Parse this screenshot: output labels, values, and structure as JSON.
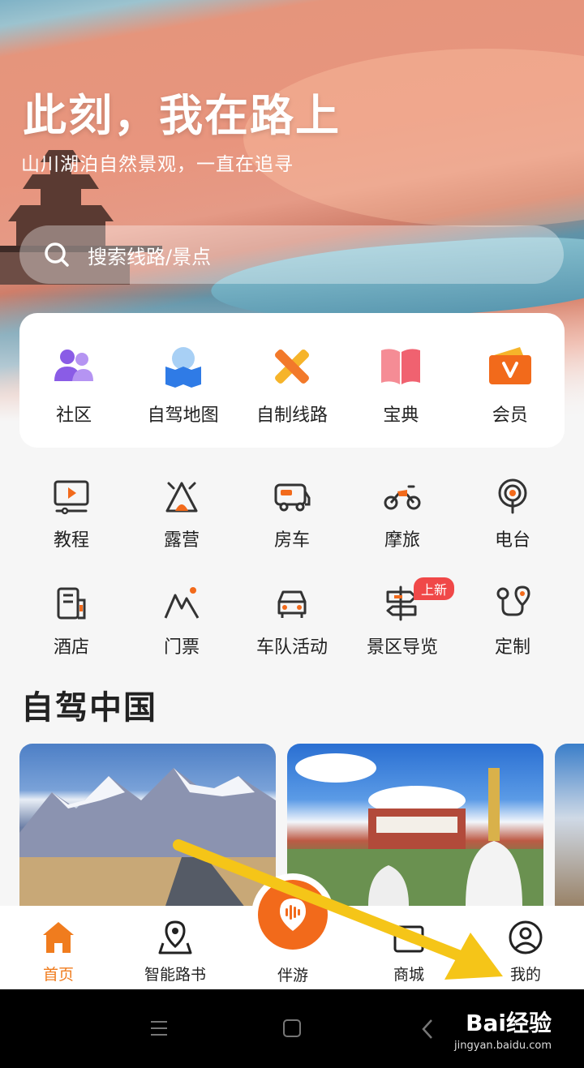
{
  "hero": {
    "title": "此刻，我在路上",
    "subtitle": "山川湖泊自然景观，一直在追寻",
    "search_placeholder": "搜索线路/景点"
  },
  "primary_menu": [
    {
      "label": "社区",
      "icon": "community-icon"
    },
    {
      "label": "自驾地图",
      "icon": "map-icon"
    },
    {
      "label": "自制线路",
      "icon": "route-icon"
    },
    {
      "label": "宝典",
      "icon": "book-icon"
    },
    {
      "label": "会员",
      "icon": "vip-icon"
    }
  ],
  "secondary_menu": [
    {
      "label": "教程",
      "icon": "tutorial-icon"
    },
    {
      "label": "露营",
      "icon": "camping-icon"
    },
    {
      "label": "房车",
      "icon": "rv-icon"
    },
    {
      "label": "摩旅",
      "icon": "motorcycle-icon"
    },
    {
      "label": "电台",
      "icon": "radio-icon"
    },
    {
      "label": "酒店",
      "icon": "hotel-icon"
    },
    {
      "label": "门票",
      "icon": "ticket-icon"
    },
    {
      "label": "车队活动",
      "icon": "convoy-icon"
    },
    {
      "label": "景区导览",
      "icon": "guide-icon",
      "badge": "上新"
    },
    {
      "label": "定制",
      "icon": "custom-icon"
    }
  ],
  "section": {
    "title": "自驾中国"
  },
  "bottom_nav": [
    {
      "label": "首页",
      "icon": "home-icon",
      "active": true
    },
    {
      "label": "智能路书",
      "icon": "roadbook-icon"
    },
    {
      "label": "伴游",
      "icon": "companion-icon"
    },
    {
      "label": "商城",
      "icon": "shop-icon"
    },
    {
      "label": "我的",
      "icon": "profile-icon"
    }
  ],
  "watermark": {
    "main": "Bai经验",
    "url": "jingyan.baidu.com"
  },
  "colors": {
    "accent": "#f07c1e",
    "badge": "#f04848",
    "arrow": "#f5c518"
  }
}
